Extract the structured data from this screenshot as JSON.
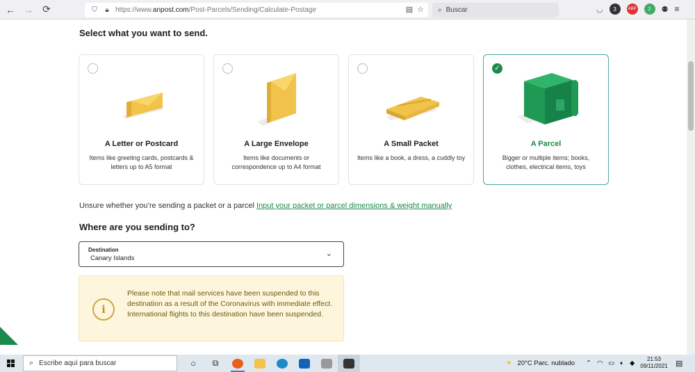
{
  "browser": {
    "url_prefix": "https://www.",
    "url_host": "anpost.com",
    "url_path": "/Post-Parcels/Sending/Calculate-Postage",
    "search_placeholder": "Buscar",
    "badges": [
      "3",
      "ABP",
      "2"
    ]
  },
  "page": {
    "heading_send": "Select what you want to send.",
    "options": [
      {
        "title": "A Letter or Postcard",
        "desc": "Items like greeting cards, postcards & letters up to A5 format",
        "selected": false
      },
      {
        "title": "A Large Envelope",
        "desc": "Items like documents or correspondence up to A4 format",
        "selected": false
      },
      {
        "title": "A Small Packet",
        "desc": "Items like a book, a dress, a cuddly toy",
        "selected": false
      },
      {
        "title": "A Parcel",
        "desc": "Bigger or multiple items; books, clothes, electrical items, toys",
        "selected": true
      }
    ],
    "unsure_text": "Unsure whether you’re sending a packet or a parcel",
    "unsure_link": "Input your packet or parcel dimensions & weight manually",
    "heading_dest": "Where are you sending to?",
    "destination_label": "Destination",
    "destination_value": "Canary Islands",
    "notice_icon": "i",
    "notice_text": "Please note that mail services have been suspended to this destination as a result of the Coronavirus with immediate effect. International flights to this destination have been suspended."
  },
  "taskbar": {
    "search_placeholder": "Escribe aquí para buscar",
    "weather": "20°C  Parc. nublado",
    "time": "21:53",
    "date": "09/11/2021"
  },
  "colors": {
    "accent_green": "#1b8a4a",
    "notice_bg": "#fdf6dc",
    "selected_border": "#4aa8a0"
  }
}
